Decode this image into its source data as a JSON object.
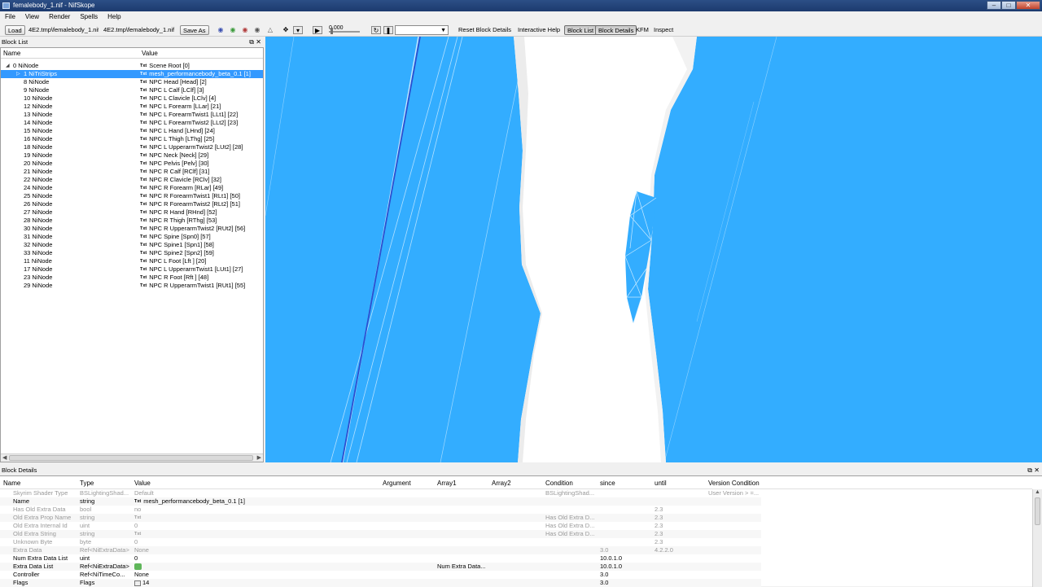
{
  "window": {
    "title": "femalebody_1.nif - NifSkope"
  },
  "menu": [
    "File",
    "View",
    "Render",
    "Spells",
    "Help"
  ],
  "toolbar": {
    "load": "Load",
    "path1": "4E2.tmp\\femalebody_1.nif",
    "path2": "4E2.tmp\\femalebody_1.nif",
    "save_as": "Save As",
    "time_value": "0.000",
    "reset_block_details": "Reset Block Details",
    "interactive_help": "Interactive Help",
    "block_list": "Block List",
    "block_details": "Block Details",
    "kfm": "KFM",
    "inspect": "Inspect"
  },
  "block_list": {
    "title": "Block List",
    "col_name": "Name",
    "col_value": "Value",
    "rows": [
      {
        "name": "0 NiNode",
        "value": "Scene Root [0]"
      },
      {
        "name": "1 NiTriStrips",
        "value": "mesh_performancebody_beta_0.1 [1]"
      },
      {
        "name": "8 NiNode",
        "value": "NPC Head [Head] [2]"
      },
      {
        "name": "9 NiNode",
        "value": "NPC L Calf [LClf] [3]"
      },
      {
        "name": "10 NiNode",
        "value": "NPC L Clavicle [LClv] [4]"
      },
      {
        "name": "12 NiNode",
        "value": "NPC L Forearm [LLar] [21]"
      },
      {
        "name": "13 NiNode",
        "value": "NPC L ForearmTwist1 [LLt1] [22]"
      },
      {
        "name": "14 NiNode",
        "value": "NPC L ForearmTwist2 [LLt2] [23]"
      },
      {
        "name": "15 NiNode",
        "value": "NPC L Hand [LHnd] [24]"
      },
      {
        "name": "16 NiNode",
        "value": "NPC L Thigh [LThg] [25]"
      },
      {
        "name": "18 NiNode",
        "value": "NPC L UpperarmTwist2 [LUt2] [28]"
      },
      {
        "name": "19 NiNode",
        "value": "NPC Neck [Neck] [29]"
      },
      {
        "name": "20 NiNode",
        "value": "NPC Pelvis [Pelv] [30]"
      },
      {
        "name": "21 NiNode",
        "value": "NPC R Calf [RClf] [31]"
      },
      {
        "name": "22 NiNode",
        "value": "NPC R Clavicle [RClv] [32]"
      },
      {
        "name": "24 NiNode",
        "value": "NPC R Forearm [RLar] [49]"
      },
      {
        "name": "25 NiNode",
        "value": "NPC R ForearmTwist1 [RLt1] [50]"
      },
      {
        "name": "26 NiNode",
        "value": "NPC R ForearmTwist2 [RLt2] [51]"
      },
      {
        "name": "27 NiNode",
        "value": "NPC R Hand [RHnd] [52]"
      },
      {
        "name": "28 NiNode",
        "value": "NPC R Thigh [RThg] [53]"
      },
      {
        "name": "30 NiNode",
        "value": "NPC R UpperarmTwist2 [RUt2] [56]"
      },
      {
        "name": "31 NiNode",
        "value": "NPC Spine [Spn0] [57]"
      },
      {
        "name": "32 NiNode",
        "value": "NPC Spine1 [Spn1] [58]"
      },
      {
        "name": "33 NiNode",
        "value": "NPC Spine2 [Spn2] [59]"
      },
      {
        "name": "11 NiNode",
        "value": "NPC L Foot [Lft ] [20]"
      },
      {
        "name": "17 NiNode",
        "value": "NPC L UpperarmTwist1 [LUt1] [27]"
      },
      {
        "name": "23 NiNode",
        "value": "NPC R Foot [Rft ] [48]"
      },
      {
        "name": "29 NiNode",
        "value": "NPC R UpperarmTwist1 [RUt1] [55]"
      }
    ]
  },
  "block_details": {
    "title": "Block Details",
    "columns": {
      "name": "Name",
      "type": "Type",
      "value": "Value",
      "argument": "Argument",
      "array1": "Array1",
      "array2": "Array2",
      "condition": "Condition",
      "since": "since",
      "until": "until",
      "version_condition": "Version Condition"
    },
    "rows": [
      {
        "name": "Skyrim Shader Type",
        "type": "BSLightingShad...",
        "value": "Default",
        "argument": "",
        "array1": "",
        "condition": "BSLightingShad...",
        "since": "",
        "until": "",
        "vcond": "User Version > =..."
      },
      {
        "name": "Name",
        "type": "string",
        "value": "mesh_performancebody_beta_0.1 [1]",
        "argument": "",
        "array1": "",
        "condition": "",
        "since": "",
        "until": "",
        "vcond": ""
      },
      {
        "name": "Has Old Extra Data",
        "type": "bool",
        "value": "no",
        "argument": "",
        "array1": "",
        "condition": "",
        "since": "",
        "until": "2.3",
        "vcond": ""
      },
      {
        "name": "Old Extra Prop Name",
        "type": "string",
        "value": "",
        "argument": "",
        "array1": "",
        "condition": "Has Old Extra D...",
        "since": "",
        "until": "2.3",
        "vcond": ""
      },
      {
        "name": "Old Extra Internal Id",
        "type": "uint",
        "value": "0",
        "argument": "",
        "array1": "",
        "condition": "Has Old Extra D...",
        "since": "",
        "until": "2.3",
        "vcond": ""
      },
      {
        "name": "Old Extra String",
        "type": "string",
        "value": "",
        "argument": "",
        "array1": "",
        "condition": "Has Old Extra D...",
        "since": "",
        "until": "2.3",
        "vcond": ""
      },
      {
        "name": "Unknown Byte",
        "type": "byte",
        "value": "0",
        "argument": "",
        "array1": "",
        "condition": "",
        "since": "",
        "until": "2.3",
        "vcond": ""
      },
      {
        "name": "Extra Data",
        "type": "Ref<NiExtraData>",
        "value": "None",
        "argument": "",
        "array1": "",
        "condition": "",
        "since": "3.0",
        "until": "4.2.2.0",
        "vcond": ""
      },
      {
        "name": "Num Extra Data List",
        "type": "uint",
        "value": "0",
        "argument": "",
        "array1": "",
        "condition": "",
        "since": "10.0.1.0",
        "until": "",
        "vcond": ""
      },
      {
        "name": "Extra Data List",
        "type": "Ref<NiExtraData>",
        "value": "",
        "argument": "",
        "array1": "Num Extra Data...",
        "condition": "",
        "since": "10.0.1.0",
        "until": "",
        "vcond": ""
      },
      {
        "name": "Controller",
        "type": "Ref<NiTimeCo...",
        "value": "None",
        "argument": "",
        "array1": "",
        "condition": "",
        "since": "3.0",
        "until": "",
        "vcond": ""
      },
      {
        "name": "Flags",
        "type": "Flags",
        "value": "14",
        "argument": "",
        "array1": "",
        "condition": "",
        "since": "3.0",
        "until": "",
        "vcond": ""
      }
    ]
  },
  "colors": {
    "viewport_bg": "#33adff",
    "selection": "#3399ff",
    "titlebar": "#1c3a6e"
  }
}
